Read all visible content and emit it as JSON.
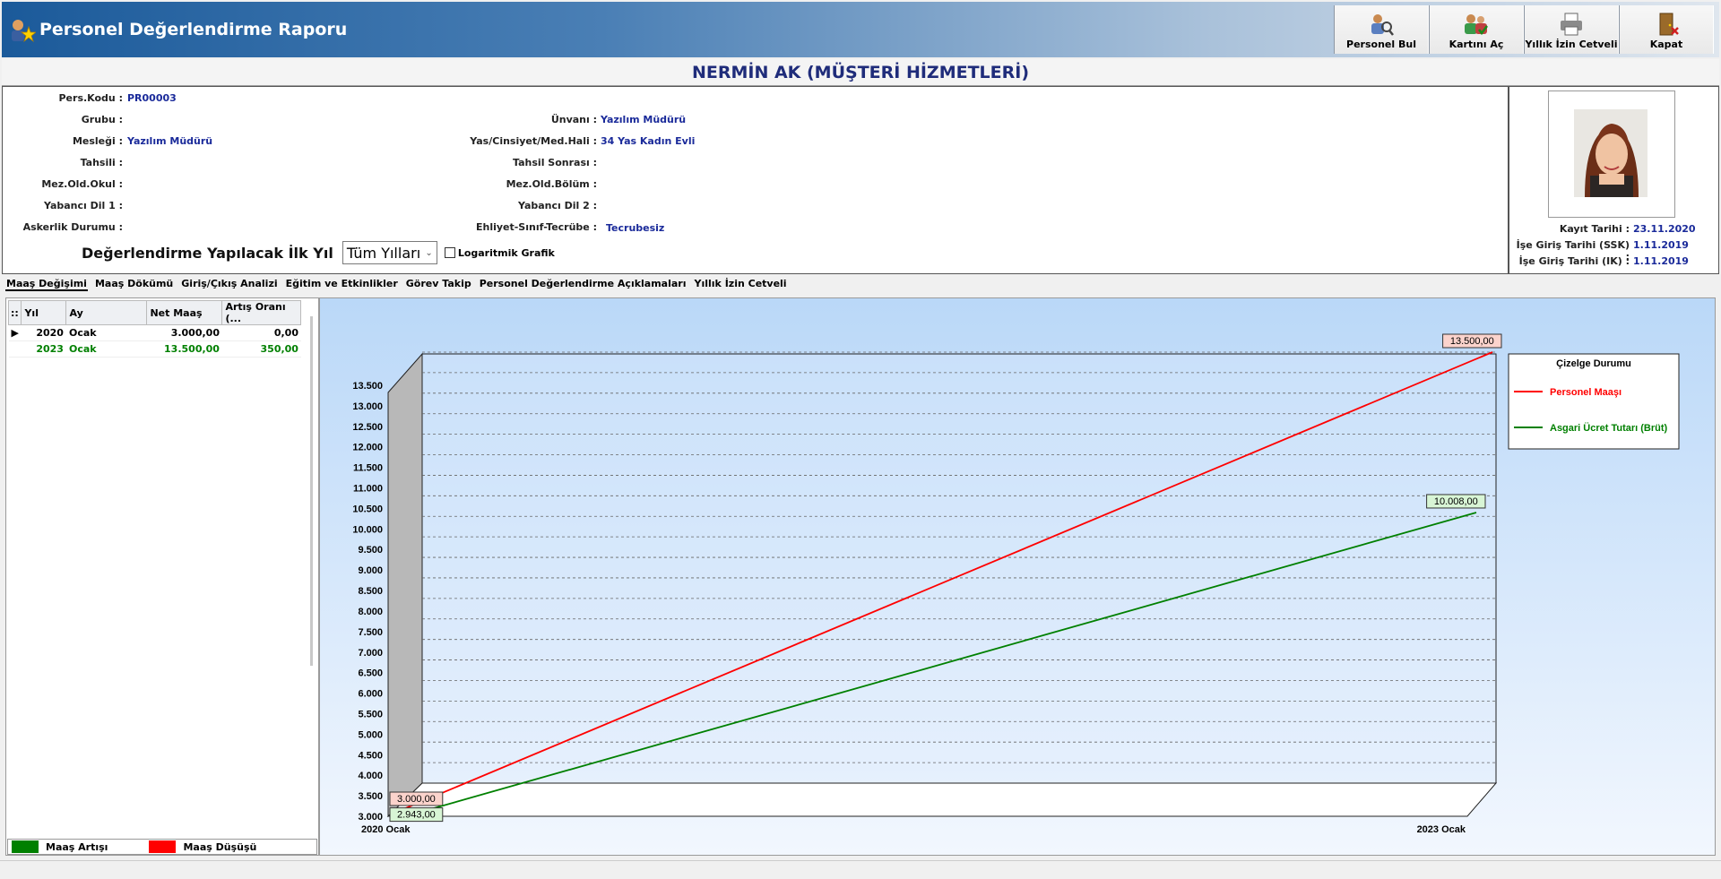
{
  "window": {
    "title": "Personel Değerlendirme Raporu"
  },
  "toolbar": {
    "buttons": [
      {
        "label": "Personel Bul",
        "icon": "search-person-icon"
      },
      {
        "label": "Kartını Aç",
        "icon": "open-card-icon"
      },
      {
        "label": "Yıllık İzin Cetveli",
        "icon": "printer-icon"
      },
      {
        "label": "Kapat",
        "icon": "door-exit-icon"
      }
    ]
  },
  "employee": {
    "header": "NERMİN AK (MÜŞTERİ HİZMETLERİ)",
    "fields_left": [
      {
        "label": "Pers.Kodu :",
        "value": "PR00003"
      },
      {
        "label": "Grubu :",
        "value": ""
      },
      {
        "label": "Mesleği :",
        "value": "Yazılım Müdürü"
      },
      {
        "label": "Tahsili :",
        "value": ""
      },
      {
        "label": "Mez.Old.Okul :",
        "value": ""
      },
      {
        "label": "Yabancı Dil 1 :",
        "value": ""
      },
      {
        "label": "Askerlik Durumu :",
        "value": ""
      }
    ],
    "fields_right": [
      {
        "label": "Ünvanı :",
        "value": "Yazılım Müdürü"
      },
      {
        "label": "Yas/Cinsiyet/Med.Hali :",
        "value": "34 Yas Kadın Evli"
      },
      {
        "label": "Tahsil Sonrası :",
        "value": ""
      },
      {
        "label": "Mez.Old.Bölüm :",
        "value": ""
      },
      {
        "label": "Yabancı Dil 2 :",
        "value": ""
      },
      {
        "label": "Ehliyet-Sınıf-Tecrübe :",
        "value": "Tecrubesiz"
      }
    ],
    "dates": [
      {
        "label": "Kayıt Tarihi :",
        "value": "23.11.2020"
      },
      {
        "label": "İşe Giriş Tarihi (SSK) :",
        "value": "1.11.2019"
      },
      {
        "label": "İşe Giriş Tarihi (IK) :",
        "value": "1.11.2019"
      }
    ]
  },
  "evaluation": {
    "label": "Değerlendirme Yapılacak İlk Yıl",
    "year_select": "Tüm Yılları",
    "log_checkbox": "Logaritmik Grafik"
  },
  "tabs": [
    "Maaş Değişimi",
    "Maaş Dökümü",
    "Giriş/Çıkış Analizi",
    "Eğitim ve Etkinlikler",
    "Görev Takip",
    "Personel Değerlendirme Açıklamaları",
    "Yıllık İzin Cetveli"
  ],
  "salary_table": {
    "corner": "::",
    "columns": [
      "Yıl",
      "Ay",
      "Net Maaş",
      "Artış Oranı (..."
    ],
    "rows": [
      {
        "year": "2020",
        "month": "Ocak",
        "net": "3.000,00",
        "rate": "0,00"
      },
      {
        "year": "2023",
        "month": "Ocak",
        "net": "13.500,00",
        "rate": "350,00"
      }
    ]
  },
  "legend_strip": {
    "increase": "Maaş Artışı",
    "decrease": "Maaş Düşüşü"
  },
  "colors": {
    "increase": "#008000",
    "decrease": "#ff0000",
    "accent": "#1b5a9a"
  },
  "chart_data": {
    "type": "line",
    "categories": [
      "2020 Ocak",
      "2023 Ocak"
    ],
    "series": [
      {
        "name": "Personel Maaşı",
        "values": [
          3000,
          13500
        ],
        "labels": [
          "3.000,00",
          "13.500,00"
        ],
        "color": "#ff0000"
      },
      {
        "name": "Asgari Ücret Tutarı (Brüt)",
        "values": [
          2943,
          10008
        ],
        "labels": [
          "2.943,00",
          "10.008,00"
        ],
        "color": "#008000"
      }
    ],
    "ylim": [
      3000,
      13500
    ],
    "yticks": [
      "3.000",
      "3.500",
      "4.000",
      "4.500",
      "5.000",
      "5.500",
      "6.000",
      "6.500",
      "7.000",
      "7.500",
      "8.000",
      "8.500",
      "9.000",
      "9.500",
      "10.000",
      "10.500",
      "11.000",
      "11.500",
      "12.000",
      "12.500",
      "13.000",
      "13.500"
    ],
    "legend_title": "Çizelge Durumu",
    "legend_position": "top-right",
    "grid": true
  }
}
